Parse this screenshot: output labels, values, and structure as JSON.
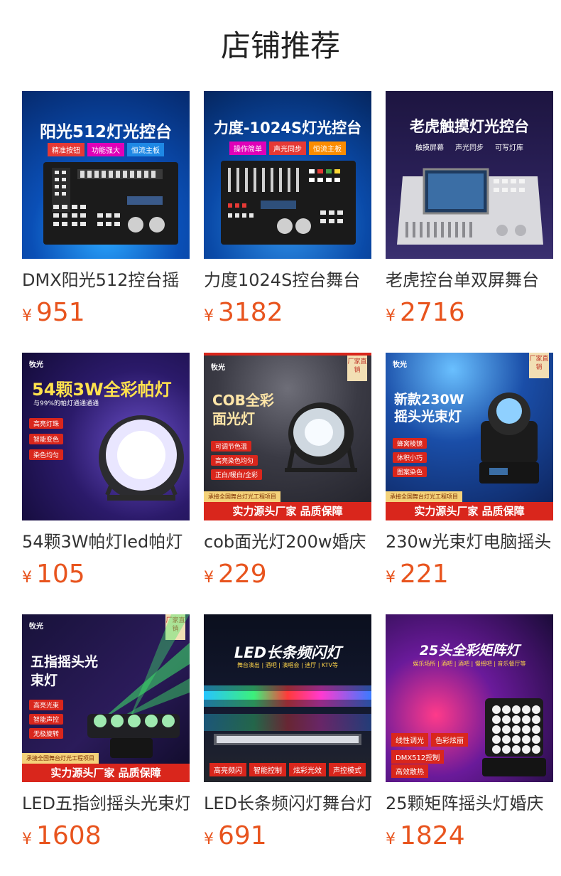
{
  "section_title": "店铺推荐",
  "currency": "¥",
  "brand": "牧光",
  "factory_badge": "厂家直销",
  "products": [
    {
      "name": "DMX阳光512控台摇",
      "price": "951",
      "img": {
        "title": "阳光512灯光控台",
        "tags": [
          "精准按钮",
          "功能强大",
          "恒流主板"
        ]
      }
    },
    {
      "name": "力度1024S控台舞台",
      "price": "3182",
      "img": {
        "title": "力度-1024S灯光控台",
        "tags": [
          "操作简单",
          "声光同步",
          "恒流主板"
        ]
      }
    },
    {
      "name": "老虎控台单双屏舞台",
      "price": "2716",
      "img": {
        "title": "老虎触摸灯光控台",
        "tags": [
          "触摸屏幕",
          "声光同步",
          "可写灯库"
        ]
      }
    },
    {
      "name": "54颗3W帕灯led帕灯",
      "price": "105",
      "img": {
        "title": "54颗3W全彩帕灯",
        "subtitle": "与99%的帕灯通通通通",
        "features": [
          "高亮灯珠",
          "智能变色",
          "染色均匀"
        ]
      }
    },
    {
      "name": "cob面光灯200w婚庆",
      "price": "229",
      "img": {
        "title": "COB全彩面光灯",
        "features": [
          "可调节色温",
          "高亮染色均匀",
          "正白/暖白/全彩"
        ],
        "sub": "承接全国舞台灯光工程项目",
        "bar": "实力源头厂家 品质保障"
      }
    },
    {
      "name": "230w光束灯电脑摇头",
      "price": "221",
      "img": {
        "title": "新款230W摇头光束灯",
        "features": [
          "蜂窝棱镜",
          "体积小巧",
          "图案染色"
        ],
        "sub": "承接全国舞台灯光工程项目",
        "bar": "实力源头厂家 品质保障"
      }
    },
    {
      "name": "LED五指剑摇头光束灯",
      "price": "1608",
      "img": {
        "title": "五指摇头光束灯",
        "features": [
          "高亮光束",
          "智能声控",
          "无极旋转"
        ],
        "sub": "承接全国舞台灯光工程项目",
        "bar": "实力源头厂家 品质保障"
      }
    },
    {
      "name": "LED长条频闪灯舞台灯",
      "price": "691",
      "img": {
        "title": "LED长条频闪灯",
        "subtitle": "舞台演出 | 酒吧 | 演唱会 | 迪厅 | KTV等",
        "tags": [
          "高亮频闪",
          "智能控制",
          "炫彩光效",
          "声控模式"
        ]
      }
    },
    {
      "name": "25颗矩阵摇头灯婚庆",
      "price": "1824",
      "img": {
        "title": "25头全彩矩阵灯",
        "subtitle": "娱乐场所 | 酒吧 | 酒吧 | 慢摇吧 | 音乐餐厅等",
        "tags": [
          "线性调光",
          "色彩炫丽",
          "DMX512控制",
          "高效散热"
        ]
      }
    }
  ]
}
